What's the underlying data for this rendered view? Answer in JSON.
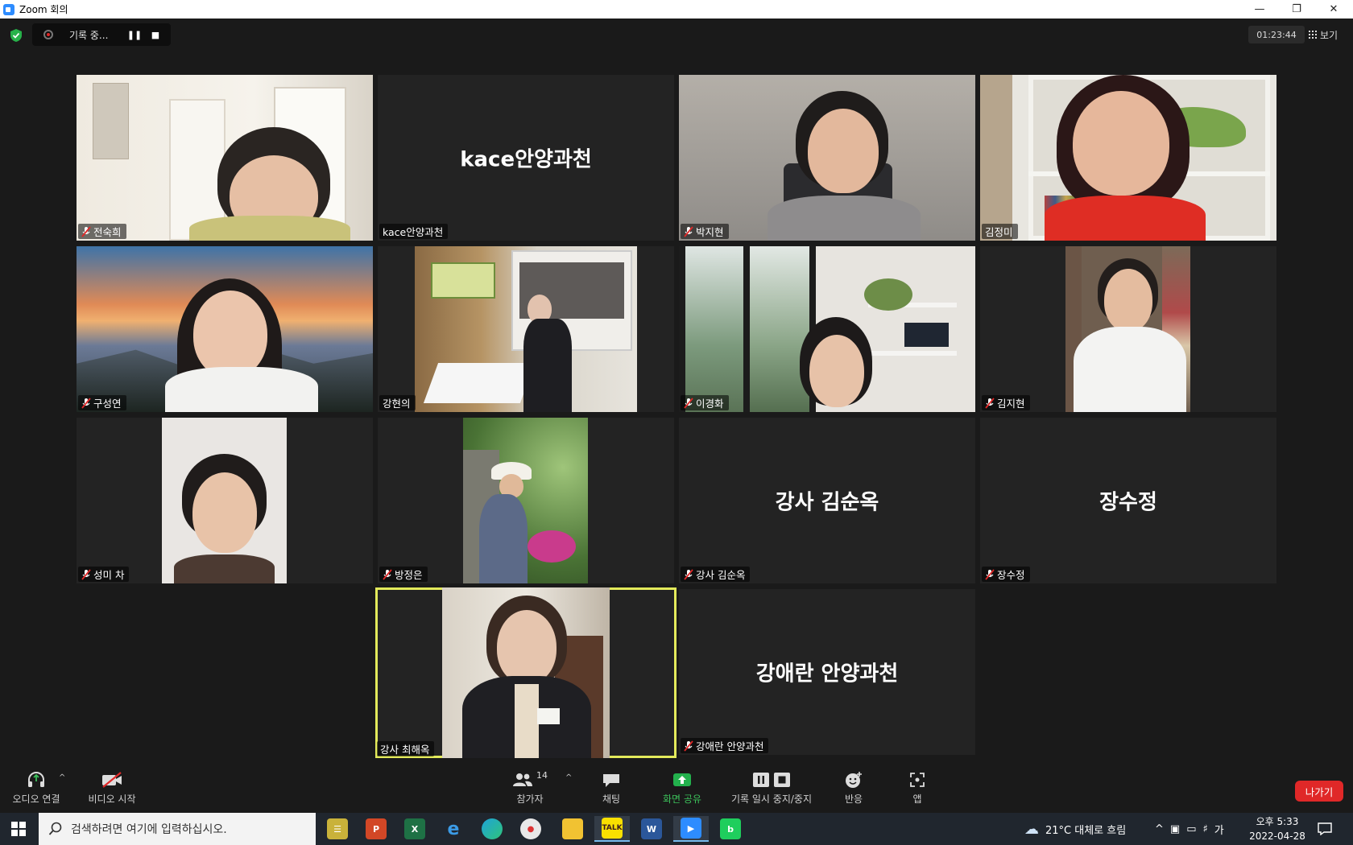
{
  "window": {
    "title": "Zoom 회의"
  },
  "topbar": {
    "recording_label": "기록 중...",
    "timer": "01:23:44",
    "view_label": "보기"
  },
  "tiles": [
    {
      "name": "전숙희",
      "muted": true
    },
    {
      "name": "kace안양과천",
      "big_name": "kace안양과천",
      "muted": false
    },
    {
      "name": "박지현",
      "muted": true
    },
    {
      "name": "김정미",
      "muted": false
    },
    {
      "name": "구성연",
      "muted": true
    },
    {
      "name": "강현의",
      "muted": false
    },
    {
      "name": "이경화",
      "muted": true
    },
    {
      "name": "김지현",
      "muted": true
    },
    {
      "name": "성미 차",
      "muted": true
    },
    {
      "name": "방정은",
      "muted": true
    },
    {
      "name": "강사 김순옥",
      "big_name": "강사 김순옥",
      "muted": true
    },
    {
      "name": "장수정",
      "big_name": "장수정",
      "muted": true
    },
    {
      "name": "강사 최해옥",
      "muted": false,
      "active_speaker": true
    },
    {
      "name": "강애란 안양과천",
      "big_name": "강애란 안양과천",
      "muted": true
    }
  ],
  "toolbar": {
    "audio": "오디오 연결",
    "video": "비디오 시작",
    "participants": "참가자",
    "participants_count": "14",
    "chat": "채팅",
    "share": "화면 공유",
    "record": "기록 일시 중지/중지",
    "reactions": "반응",
    "apps": "앱",
    "leave": "나가기"
  },
  "taskbar": {
    "search_placeholder": "검색하려면 여기에 입력하십시오.",
    "weather": "21°C  대체로 흐림",
    "ime": "가",
    "time": "오후 5:33",
    "date": "2022-04-28",
    "apps": [
      "Notepad",
      "PowerPoint",
      "Excel",
      "Internet Explorer",
      "Edge",
      "Paint",
      "File Explorer",
      "KakaoTalk",
      "Word",
      "Zoom",
      "Band"
    ]
  }
}
